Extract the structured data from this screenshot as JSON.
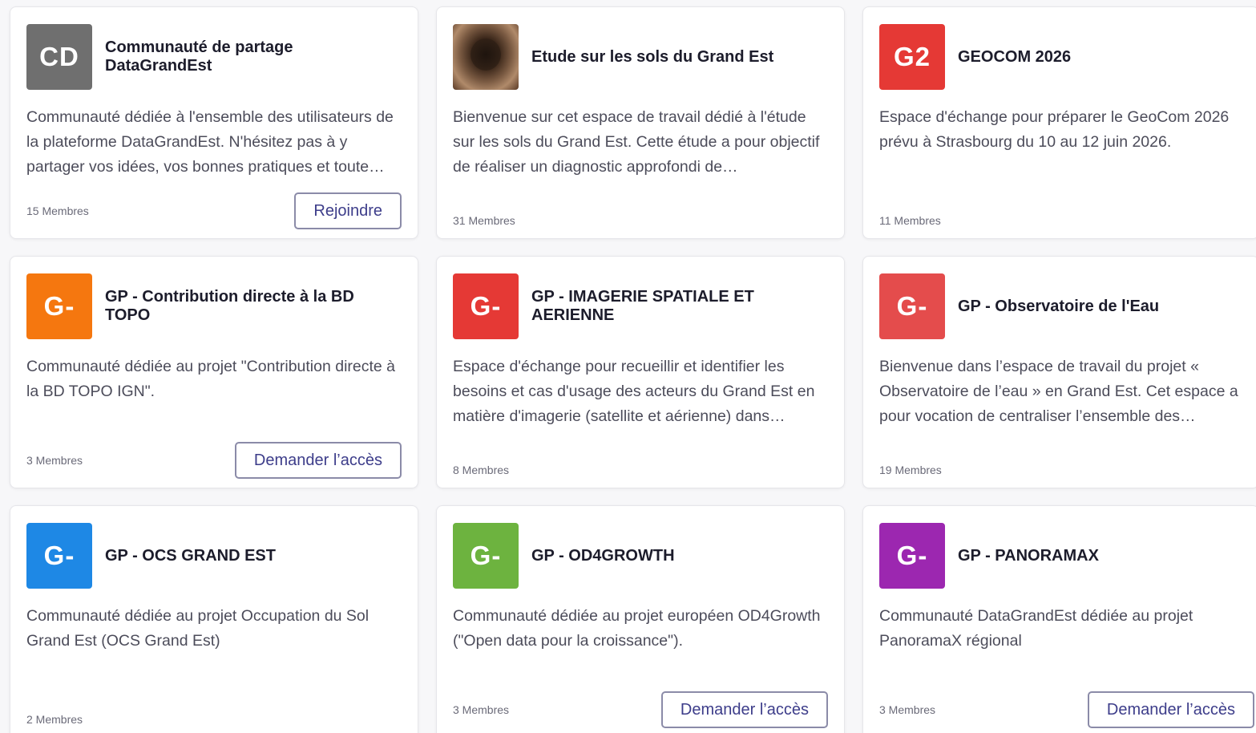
{
  "cards": [
    {
      "avatar_text": "CD",
      "avatar_color": "#6f6f6f",
      "title": "Communauté de partage DataGrandEst",
      "description": "Communauté dédiée à l'ensemble des utilisateurs de la plateforme DataGrandEst.  N'hésitez pas à y partager vos idées, vos bonnes pratiques et toute…",
      "members": "15 Membres",
      "button": "Rejoindre"
    },
    {
      "avatar_image": "soil-in-hands",
      "title": "Etude sur les sols du Grand Est",
      "description": "Bienvenue sur cet espace de travail dédié à l'étude sur les sols du Grand Est.  Cette étude a pour objectif de réaliser un diagnostic approfondi de…",
      "members": "31 Membres"
    },
    {
      "avatar_text": "G2",
      "avatar_color": "#e53935",
      "title": "GEOCOM 2026",
      "description": "Espace d'échange pour préparer le GeoCom 2026 prévu à Strasbourg du 10 au 12 juin 2026.",
      "members": "11 Membres"
    },
    {
      "avatar_text": "G-",
      "avatar_color": "#f5770f",
      "title": "GP - Contribution directe à la BD TOPO",
      "description": "Communauté dédiée au projet \"Contribution directe à la BD TOPO IGN\".",
      "members": "3 Membres",
      "button": "Demander l’accès"
    },
    {
      "avatar_text": "G-",
      "avatar_color": "#e53935",
      "title": "GP - IMAGERIE SPATIALE ET AERIENNE",
      "description": "Espace d'échange pour recueillir et identifier les besoins et cas d'usage des acteurs du Grand Est en matière d'imagerie (satellite et aérienne) dans…",
      "members": "8 Membres"
    },
    {
      "avatar_text": "G-",
      "avatar_color": "#e44c4c",
      "title": "GP - Observatoire de l'Eau",
      "description": "Bienvenue dans l’espace de travail du projet « Observatoire de l’eau » en Grand Est.  Cet espace a pour vocation de centraliser l’ensemble des…",
      "members": "19 Membres"
    },
    {
      "avatar_text": "G-",
      "avatar_color": "#1e88e5",
      "title": "GP - OCS GRAND EST",
      "description": "Communauté dédiée au projet Occupation du Sol Grand Est (OCS Grand Est)",
      "members": "2 Membres"
    },
    {
      "avatar_text": "G-",
      "avatar_color": "#6db33f",
      "title": "GP - OD4GROWTH",
      "description": "Communauté dédiée au projet européen OD4Growth (\"Open data pour la croissance\").",
      "members": "3 Membres",
      "button": "Demander l’accès"
    },
    {
      "avatar_text": "G-",
      "avatar_color": "#9c27b0",
      "title": "GP - PANORAMAX",
      "description": "Communauté DataGrandEst dédiée au projet PanoramaX régional",
      "members": "3 Membres",
      "button": "Demander l’accès"
    }
  ]
}
